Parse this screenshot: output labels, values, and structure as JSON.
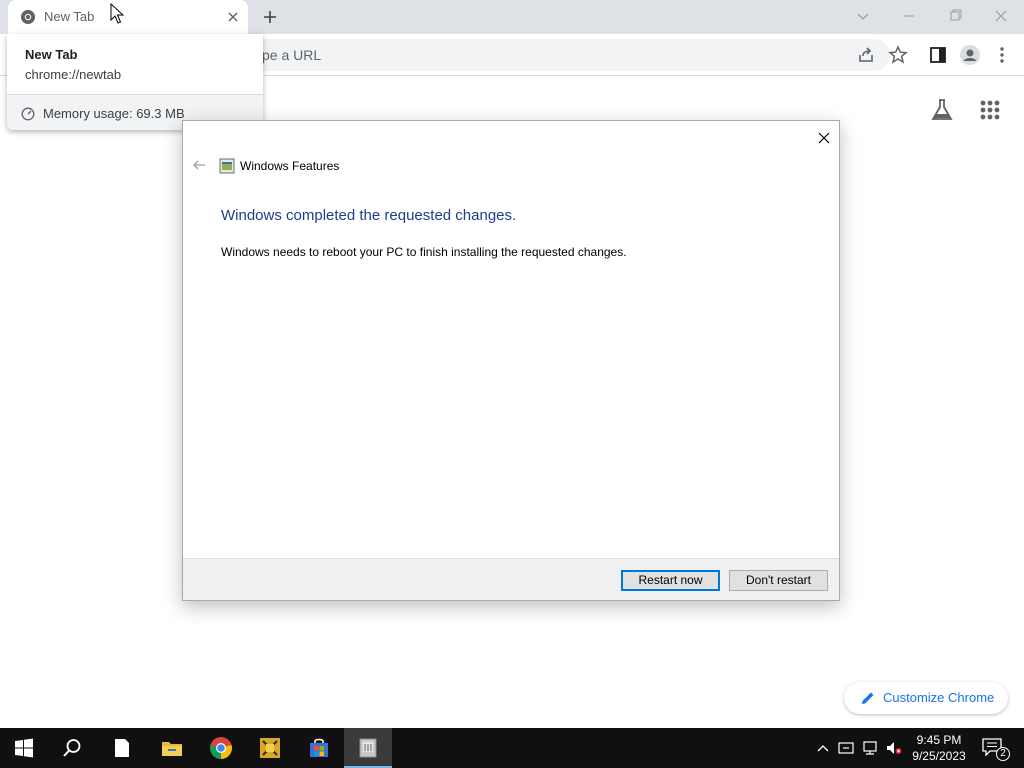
{
  "browser": {
    "tab": {
      "title": "New Tab",
      "favicon": "chrome-icon"
    },
    "omnibox": {
      "placeholder_visible": "pe a URL"
    },
    "hovercard": {
      "title": "New Tab",
      "url": "chrome://newtab",
      "memory": "Memory usage: 69.3 MB"
    },
    "ntp": {
      "customize_label": "Customize Chrome"
    },
    "icons": [
      "chrome-icon",
      "close-icon",
      "plus-icon",
      "share-icon",
      "star-icon",
      "side-panel-icon",
      "profile-icon",
      "menu-icon",
      "labs-icon",
      "apps-grid-icon",
      "pencil-icon"
    ]
  },
  "dialog": {
    "app_title": "Windows Features",
    "heading": "Windows completed the requested changes.",
    "body": "Windows needs to reboot your PC to finish installing the requested changes.",
    "buttons": {
      "primary": "Restart now",
      "secondary": "Don't restart"
    }
  },
  "taskbar": {
    "apps": [
      "start",
      "search",
      "file",
      "file-explorer",
      "chrome",
      "app-yellow",
      "microsoft-store",
      "windows-features"
    ],
    "clock": {
      "time": "9:45 PM",
      "date": "9/25/2023"
    },
    "notification_count": "2"
  },
  "colors": {
    "accent": "#1a73e8",
    "dialog_heading": "#1e3d8f",
    "button_focus": "#0078d7",
    "taskbar": "#101010"
  }
}
